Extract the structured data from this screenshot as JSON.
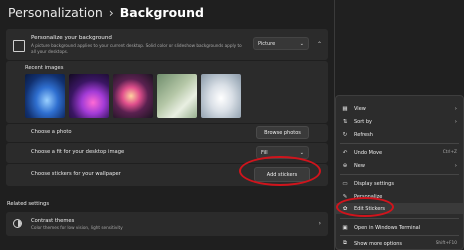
{
  "header": {
    "root": "Personalization",
    "separator": "›",
    "current": "Background"
  },
  "personalize_bg": {
    "title": "Personalize your background",
    "subtitle": "A picture background applies to your current desktop. Solid color or slideshow backgrounds apply to all your desktops.",
    "dropdown_value": "Picture",
    "dropdown_icon": "chevron-down-icon",
    "collapse_icon": "chevron-up-icon"
  },
  "recent_images": {
    "label": "Recent images"
  },
  "choose_photo": {
    "label": "Choose a photo",
    "button": "Browse photos"
  },
  "choose_fit": {
    "label": "Choose a fit for your desktop image",
    "value": "Fill"
  },
  "stickers": {
    "label": "Choose stickers for your wallpaper",
    "button": "Add stickers"
  },
  "related": {
    "heading": "Related settings",
    "contrast_title": "Contrast themes",
    "contrast_sub": "Color themes for low vision, light sensitivity"
  },
  "context_menu": {
    "items": [
      {
        "label": "View",
        "icon": "grid-icon",
        "submenu": true
      },
      {
        "label": "Sort by",
        "icon": "sort-icon",
        "submenu": true
      },
      {
        "label": "Refresh",
        "icon": "refresh-icon"
      },
      {
        "label": "Undo Move",
        "icon": "undo-icon",
        "shortcut": "Ctrl+Z"
      },
      {
        "label": "New",
        "icon": "new-icon",
        "submenu": true
      },
      {
        "label": "Display settings",
        "icon": "display-icon"
      },
      {
        "label": "Personalize",
        "icon": "brush-icon"
      },
      {
        "label": "Edit Stickers",
        "icon": "sticker-icon"
      },
      {
        "label": "Open in Windows Terminal",
        "icon": "terminal-icon"
      },
      {
        "label": "Show more options",
        "icon": "more-options-icon",
        "shortcut": "Shift+F10"
      }
    ]
  },
  "colors": {
    "highlight_ellipse": "#d0141c",
    "window_bg": "#1f1f1f",
    "card_bg": "#2b2b2b",
    "menu_bg": "#2c2c2c"
  }
}
